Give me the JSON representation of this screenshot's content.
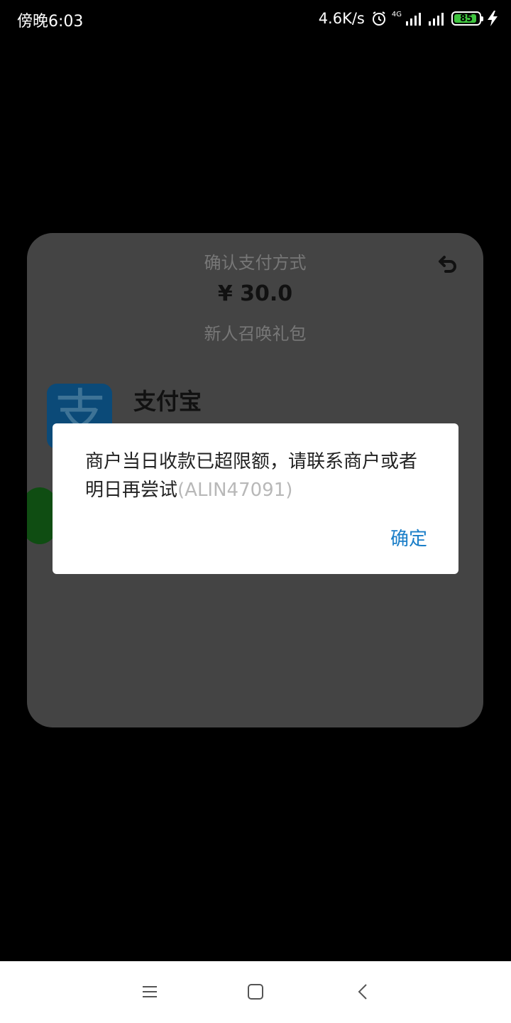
{
  "status_bar": {
    "time": "傍晚6:03",
    "net_speed": "4.6K/s",
    "alarm_icon": "alarm-icon",
    "network_type": "4G",
    "signal_icon": "signal-icon",
    "battery_level": "85",
    "charging_icon": "charging-icon"
  },
  "sheet": {
    "title": "确认支付方式",
    "amount": "¥ 30.0",
    "subtitle": "新人召唤礼包",
    "methods": [
      {
        "name": "支付宝",
        "icon": "alipay-icon",
        "glyph": "支"
      },
      {
        "icon": "wechat-pay-icon"
      }
    ]
  },
  "dialog": {
    "message": "商户当日收款已超限额，请联系商户或者明日再尝试",
    "code": "(ALIN47091)",
    "confirm_label": "确定"
  },
  "nav_bar": {
    "menu_icon": "menu-icon",
    "home_icon": "home-icon",
    "back_icon": "back-icon"
  },
  "colors": {
    "accent": "#1a7ec8",
    "alipay_blue": "#0b4a78",
    "battery_green": "#3ec43e"
  }
}
